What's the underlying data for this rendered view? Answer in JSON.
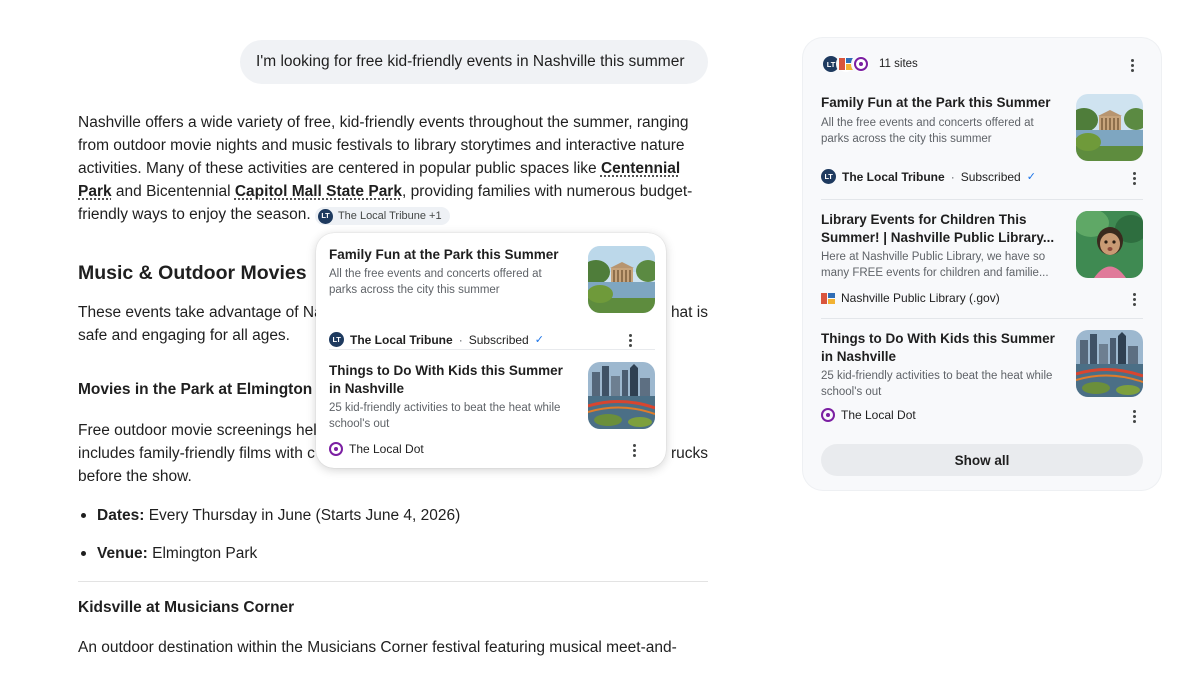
{
  "chat": {
    "query": "I'm looking for free kid-friendly events in Nashville this summer",
    "intro": {
      "text_1": "Nashville offers a wide variety of free, kid-friendly events throughout the summer, ranging from outdoor movie nights and music festivals to library storytimes and interactive nature activities. Many of these activities are centered in popular public spaces like ",
      "link_1": "Centennial Park",
      "text_2": " and Bicentennial ",
      "link_2": "Capitol Mall State Park",
      "text_3": ", providing families with numerous budget-friendly ways to enjoy the season. ",
      "chip_label": "The Local Tribune +1"
    },
    "section_heading": "Music & Outdoor Movies",
    "section_para_start": "These events take advantage of Na",
    "section_para_end": "hat is",
    "section_para_line2": "safe and engaging for all ages.",
    "subheading_1_visible": "Movies in the Park at Elmington",
    "movies_para_line1_start": "Free outdoor movie screenings hel",
    "movies_para_line1_end": "rucks",
    "movies_para_line2_start": "includes family-friendly films with c",
    "movies_para_line3": "before the show.",
    "bullets": [
      {
        "label": "Dates:",
        "value": " Every Thursday in June (Starts June 4, 2026)"
      },
      {
        "label": "Venue:",
        "value": " Elmington Park"
      }
    ],
    "subheading_2": "Kidsville at Musicians Corner",
    "kids_para_visible": "An outdoor destination within the Musicians Corner festival featuring musical meet-and-"
  },
  "popup": {
    "items": [
      {
        "title": "Family Fun at the Park this Summer",
        "desc": "All the free events and concerts offered at parks across the city this summer",
        "source": "The Local Tribune",
        "status": "Subscribed",
        "thumb_icon": "parthenon-park-photo"
      },
      {
        "title": "Things to Do With Kids this Summer in Nashville",
        "desc": "25 kid-friendly activities to beat the heat while school's out",
        "source": "The Local Dot",
        "thumb_icon": "nashville-skyline-photo"
      }
    ]
  },
  "panel": {
    "sites_count": "11 sites",
    "items": [
      {
        "title": "Family Fun at the Park this Summer",
        "desc": "All the free events and concerts offered at parks across the city this summer",
        "source": "The Local Tribune",
        "status": "Subscribed",
        "thumb_icon": "parthenon-park-photo"
      },
      {
        "title": "Library Events for Children This Summer! | Nashville Public Library...",
        "desc": "Here at Nashville Public Library, we have so many FREE events for children and familie...",
        "source": "Nashville Public Library (.gov)",
        "thumb_icon": "child-photo"
      },
      {
        "title": "Things to Do With Kids this Summer in Nashville",
        "desc": "25 kid-friendly activities to beat the heat while school's out",
        "source": "The Local Dot",
        "thumb_icon": "nashville-skyline-photo"
      }
    ],
    "show_all_label": "Show all"
  },
  "badges": {
    "local_tribune_initials": "LT"
  },
  "colors": {
    "local_tribune_badge": "#1e3a5f",
    "local_dot_badge": "#7b1fa2",
    "subscribed_check": "#1a73e8",
    "panel_bg": "#f8f9fb"
  }
}
